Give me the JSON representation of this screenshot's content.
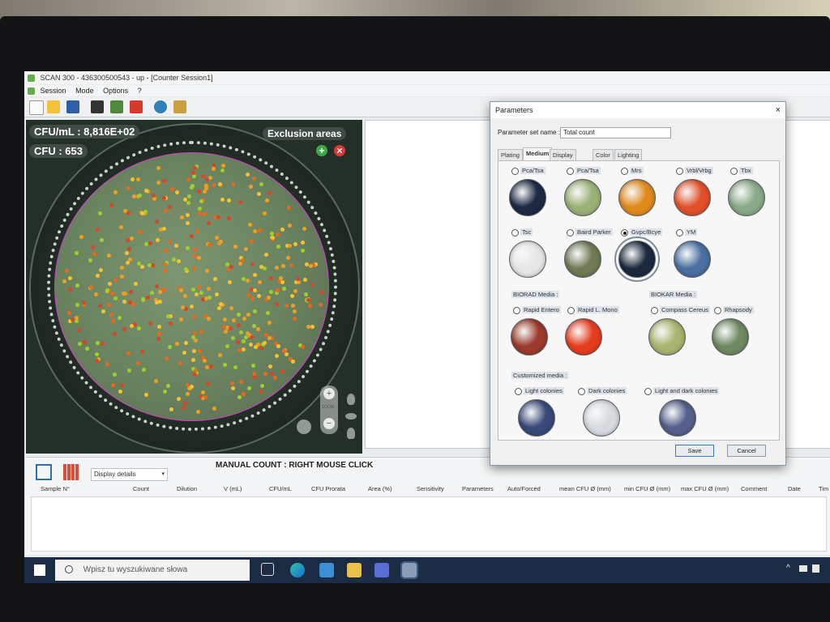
{
  "window": {
    "title": "SCAN 300 - 436300500543 - up - [Counter Session1]",
    "menu": [
      "Session",
      "Mode",
      "Options",
      "?"
    ]
  },
  "toolbar_icons": [
    "new-file-icon",
    "open-folder-icon",
    "save-icon",
    "camera-icon",
    "export-image-icon",
    "pdf-icon",
    "settings-icon",
    "edit-icon"
  ],
  "image_panel": {
    "cfu_ml": "CFU/mL : 8,816E+02",
    "cfu": "CFU : 653",
    "exclusion": "Exclusion areas",
    "zoom": "ZOOM"
  },
  "results": {
    "manual_count": "MANUAL COUNT : RIGHT MOUSE CLICK",
    "display_select": "Display details",
    "columns": [
      "Sample N°",
      "Count",
      "Dilution",
      "V (mL)",
      "CFU/mL",
      "CFU Prorata",
      "Area (%)",
      "Sensitivity",
      "Parameters",
      "Auto/Forced",
      "mean CFU Ø (mm)",
      "min CFU Ø (mm)",
      "max CFU Ø (mm)",
      "Comment",
      "Date",
      "Tim"
    ]
  },
  "dialog": {
    "title": "Parameters",
    "close": "×",
    "param_set_label": "Parameter set name :",
    "param_set_value": "Total count",
    "tabs": [
      "Plating",
      "Medium",
      "Display options",
      "Color",
      "Lighting"
    ],
    "active_tab": "Medium",
    "media_row1": [
      {
        "label": "Pca/Tsa",
        "color": "#1c2a44"
      },
      {
        "label": "Pca/Tsa",
        "color": "#9bb277"
      },
      {
        "label": "Mrs",
        "color": "#e08a1e"
      },
      {
        "label": "Vrbl/Vrbg",
        "color": "#e2502a"
      },
      {
        "label": "Tbx",
        "color": "#88aa88"
      }
    ],
    "media_row2": [
      {
        "label": "Tsc",
        "color": "#e6e6e6"
      },
      {
        "label": "Baird Parker",
        "color": "#6f7b55"
      },
      {
        "label": "Gvpc/Bcye",
        "color": "#1c2a3e",
        "selected": true
      },
      {
        "label": "YM",
        "color": "#4a6fa0"
      }
    ],
    "biorad_title": "BIORAD Media :",
    "biorad": [
      {
        "label": "Rapid Entero",
        "color": "#9c3a2c"
      },
      {
        "label": "Rapid L. Mono",
        "color": "#e63c1e"
      }
    ],
    "biokar_title": "BIOKAR Media :",
    "biokar": [
      {
        "label": "Compass Cereus",
        "color": "#a9b46f"
      },
      {
        "label": "Rhapsody",
        "color": "#6f8a62"
      }
    ],
    "custom_title": "Customized media :",
    "custom": [
      {
        "label": "Light colonies",
        "color": "#3a4a78"
      },
      {
        "label": "Dark colonies",
        "color": "#d6dbe0"
      },
      {
        "label": "Light and dark colonies",
        "color": "#55608a"
      }
    ],
    "save": "Save",
    "cancel": "Cancel"
  },
  "taskbar": {
    "search_placeholder": "Wpisz tu wyszukiwane słowa"
  }
}
